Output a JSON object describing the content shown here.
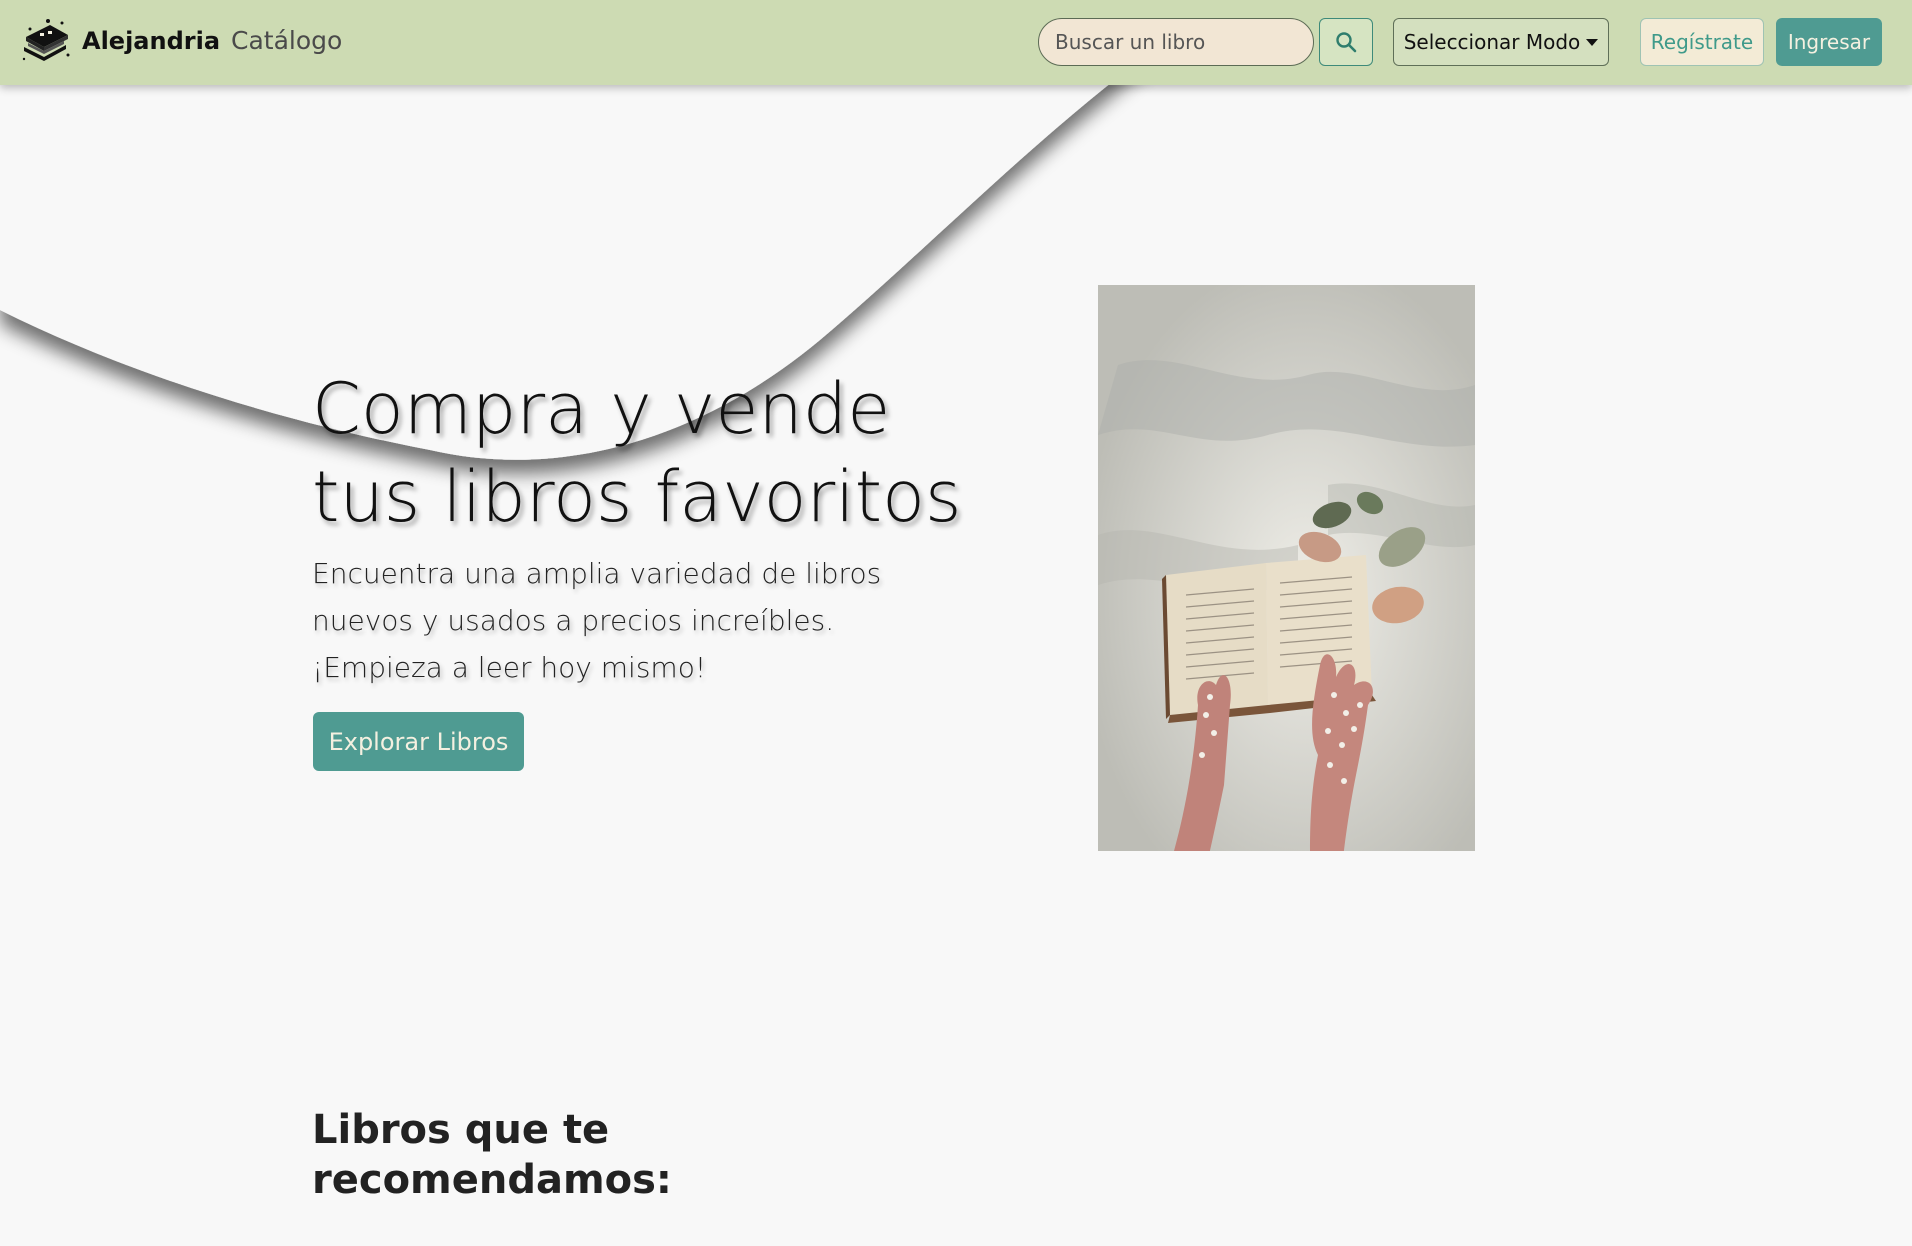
{
  "navbar": {
    "brand_name": "Alejandria",
    "catalog_link": "Catálogo",
    "search_placeholder": "Buscar un libro",
    "mode_button": "Seleccionar Modo",
    "register_button": "Regístrate",
    "login_button": "Ingresar"
  },
  "hero": {
    "title": "Compra y vende tus libros favoritos",
    "subtitle": "Encuentra una amplia variedad de libros nuevos y usados a precios increíbles. ¡Empieza a leer hoy mismo!",
    "cta_button": "Explorar Libros"
  },
  "recommended": {
    "title": "Libros que te recomendamos:"
  },
  "colors": {
    "navbar_bg": "#cddbb3",
    "accent": "#4f9b92",
    "page_bg": "#f8f8f8",
    "search_bg": "#f2e6d4"
  },
  "icons": {
    "logo": "book-stack-logo-icon",
    "search": "search-icon",
    "dropdown": "caret-down-icon"
  }
}
